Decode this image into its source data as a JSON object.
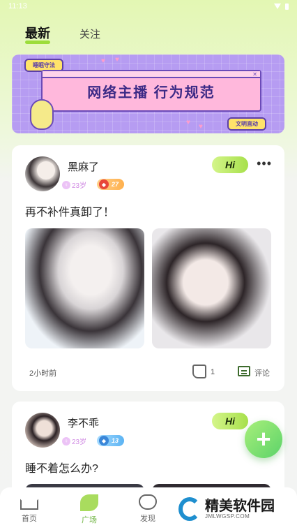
{
  "status_bar": {
    "time": "11:13"
  },
  "top_tabs": {
    "latest": "最新",
    "following": "关注"
  },
  "banner": {
    "top_tag": "睡眠守法",
    "title": "网络主播 行为规范",
    "bottom_tag": "文明直动"
  },
  "posts": [
    {
      "username": "黑麻了",
      "age": "23岁",
      "level": "27",
      "hi_label": "Hi",
      "text": "再不补件真卸了！",
      "time": "2小时前",
      "likes": "1",
      "comment_label": "评论"
    },
    {
      "username": "李不乖",
      "age": "23岁",
      "level": "13",
      "hi_label": "Hi",
      "text": "睡不着怎么办?"
    }
  ],
  "fab": {
    "label": "+"
  },
  "bottom_nav": {
    "home": "首页",
    "square": "广场",
    "discover": "发现"
  },
  "watermark": {
    "title": "精美软件园",
    "subtitle": "JMLWGSP.COM"
  }
}
